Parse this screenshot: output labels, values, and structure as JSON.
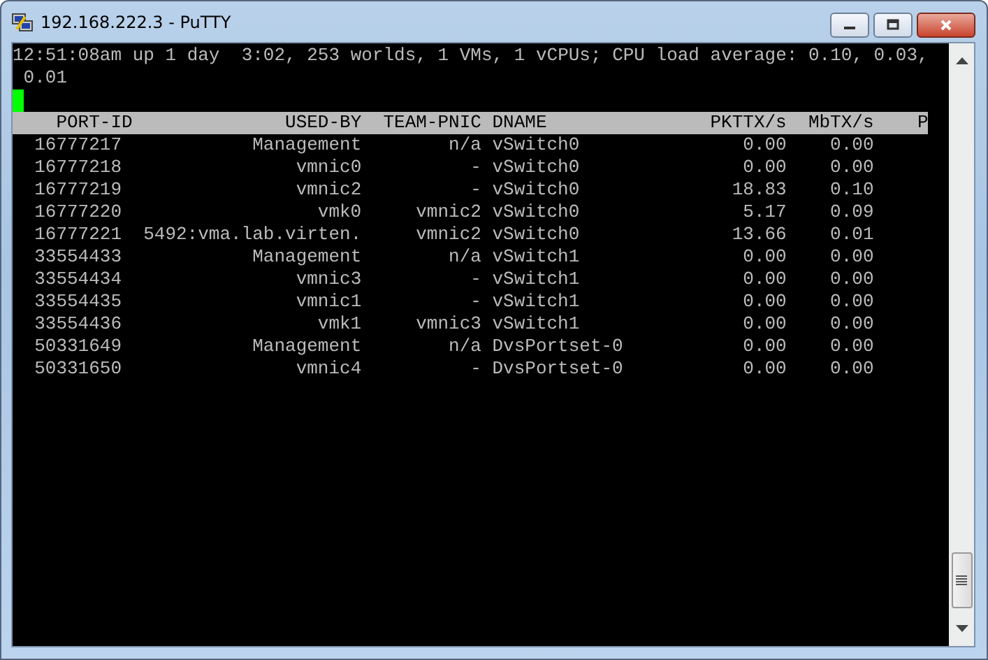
{
  "window": {
    "title": "192.168.222.3 - PuTTY"
  },
  "terminal": {
    "lines": [
      "12:51:08am up 1 day  3:02, 253 worlds, 1 VMs, 1 vCPUs; CPU load average: 0.10, 0.03,",
      " 0.01"
    ],
    "cursor": true,
    "table": {
      "columns": [
        "PORT-ID",
        "USED-BY",
        "TEAM-PNIC",
        "DNAME",
        "PKTTX/s",
        "MbTX/s",
        "P"
      ],
      "rows": [
        [
          "16777217",
          "Management",
          "n/a",
          "vSwitch0",
          "0.00",
          "0.00"
        ],
        [
          "16777218",
          "vmnic0",
          "-",
          "vSwitch0",
          "0.00",
          "0.00"
        ],
        [
          "16777219",
          "vmnic2",
          "-",
          "vSwitch0",
          "18.83",
          "0.10"
        ],
        [
          "16777220",
          "vmk0",
          "vmnic2",
          "vSwitch0",
          "5.17",
          "0.09"
        ],
        [
          "16777221",
          "5492:vma.lab.virten.",
          "vmnic2",
          "vSwitch0",
          "13.66",
          "0.01"
        ],
        [
          "33554433",
          "Management",
          "n/a",
          "vSwitch1",
          "0.00",
          "0.00"
        ],
        [
          "33554434",
          "vmnic3",
          "-",
          "vSwitch1",
          "0.00",
          "0.00"
        ],
        [
          "33554435",
          "vmnic1",
          "-",
          "vSwitch1",
          "0.00",
          "0.00"
        ],
        [
          "33554436",
          "vmk1",
          "vmnic3",
          "vSwitch1",
          "0.00",
          "0.00"
        ],
        [
          "50331649",
          "Management",
          "n/a",
          "DvsPortset-0",
          "0.00",
          "0.00"
        ],
        [
          "50331650",
          "vmnic4",
          "-",
          "DvsPortset-0",
          "0.00",
          "0.00"
        ]
      ]
    }
  }
}
